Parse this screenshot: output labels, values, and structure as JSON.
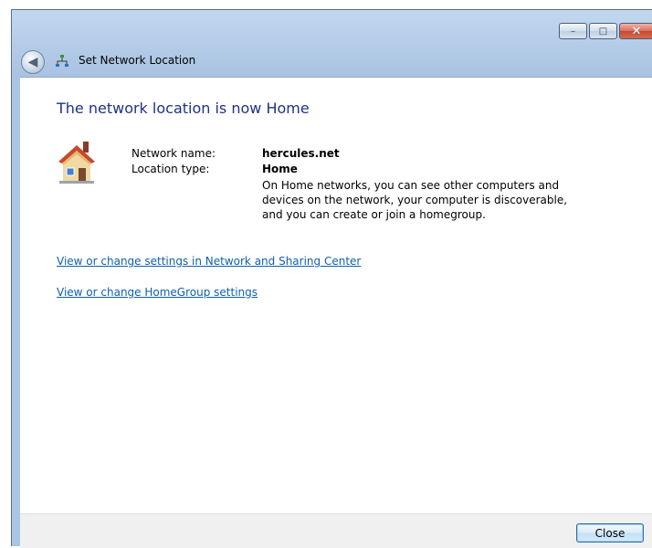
{
  "window": {
    "title": "Set Network Location",
    "controls": {
      "minimize": "–",
      "maximize": "□",
      "close": "✕"
    }
  },
  "nav": {
    "back_icon": "back-arrow-icon"
  },
  "main": {
    "heading": "The network location is now Home",
    "fields": {
      "network_name_label": "Network name:",
      "network_name_value": "hercules.net",
      "location_type_label": "Location type:",
      "location_type_value": "Home"
    },
    "description": "On Home networks, you can see other computers and devices on the network, your computer is discoverable, and you can create or join a homegroup.",
    "links": {
      "network_sharing": "View or change settings in Network and Sharing Center",
      "homegroup": "View or change HomeGroup settings"
    }
  },
  "footer": {
    "close_label": "Close"
  },
  "colors": {
    "heading": "#1e3287",
    "link": "#0f5fb0",
    "frame": "#a9c5e3"
  }
}
